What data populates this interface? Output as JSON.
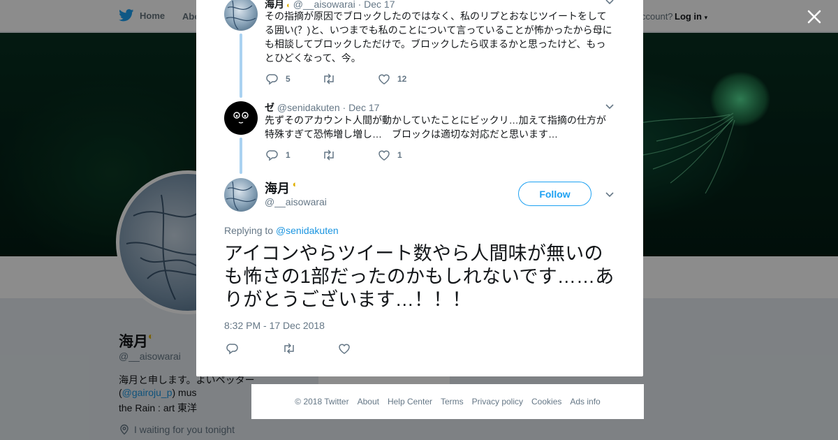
{
  "nav": {
    "home_label": "Home",
    "about_label": "Abo",
    "account_text": "ccount?",
    "login_label": "Log in"
  },
  "profile": {
    "name": "海月",
    "handle": "@__aisowarai",
    "bio_line1": "海月と申します。よいペッター",
    "bio_line2_pre": "(",
    "bio_line2_link": "@gairoju_p",
    "bio_line2_post": ") mus",
    "bio_line3": "the Rain : art 東洋",
    "location": "I waiting for you tonight",
    "side_card_text": "Ads info"
  },
  "thread": [
    {
      "name": "海月",
      "handle": "@__aisowarai",
      "date": "Dec 17",
      "text": "その指摘が原因でブロックしたのではなく、私のリプとおなじツイートをしてる囲い(？)と、いつまでも私のことについて言っていることが怖かったから母にも相談してブロックしただけで。ブロックしたら収まるかと思ったけど、もっとひどくなって、今。",
      "replies": "5",
      "retweets": "",
      "likes": "12"
    },
    {
      "name": "ゼ",
      "handle": "@senidakuten",
      "date": "Dec 17",
      "text": "先ずそのアカウント人間が動かしていたことにビックリ…加えて指摘の仕方が特殊すぎて恐怖増し増し…　ブロックは適切な対応だと思います…",
      "replies": "1",
      "retweets": "",
      "likes": "1"
    }
  ],
  "main_tweet": {
    "name": "海月",
    "handle": "@__aisowarai",
    "follow_label": "Follow",
    "replying_to_label": "Replying to",
    "replying_to_handle": "@senidakuten",
    "text": "アイコンやらツイート数やら人間味が無いのも怖さの1部だったのかもしれないです……ありがとうございます…！！！",
    "timestamp": "8:32 PM - 17 Dec 2018"
  },
  "footer": {
    "links": [
      "© 2018 Twitter",
      "About",
      "Help Center",
      "Terms",
      "Privacy policy",
      "Cookies",
      "Ads info"
    ]
  },
  "colors": {
    "brand": "#1da1f2",
    "link": "#1b95e0",
    "thread_line": "#aad2f1",
    "muted": "#657786"
  },
  "icons": [
    "twitter-bird-icon",
    "close-icon",
    "chevron-down-icon",
    "reply-icon",
    "retweet-icon",
    "like-icon",
    "location-icon",
    "moon-emoji-icon"
  ]
}
